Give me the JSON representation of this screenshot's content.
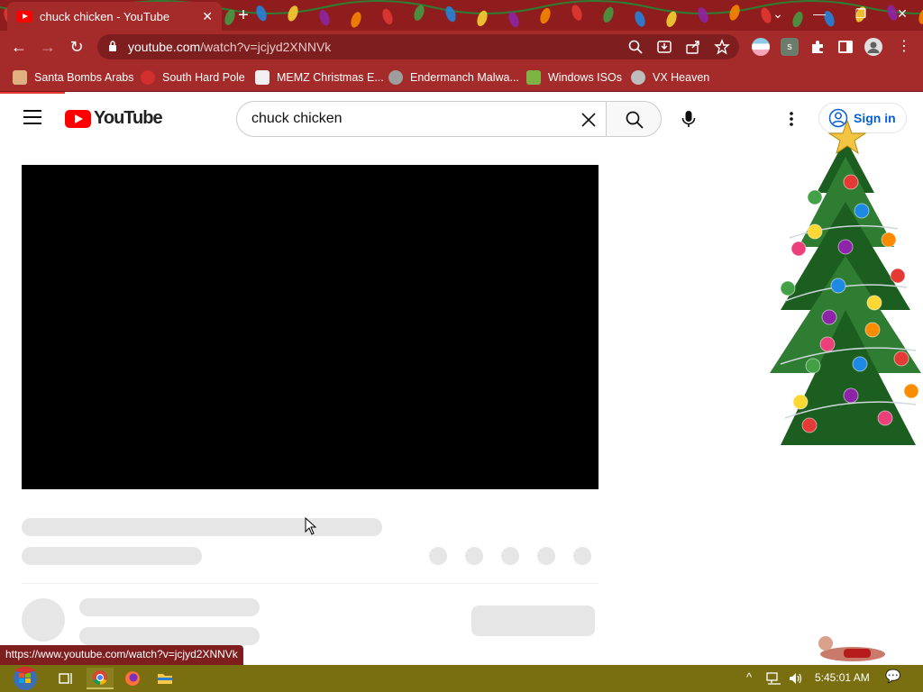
{
  "browser": {
    "tab": {
      "title": "chuck chicken - YouTube",
      "close": "✕"
    },
    "new_tab": "+",
    "window": {
      "chevron": "⌄",
      "minimize": "—",
      "restore": "❐",
      "close": "✕"
    },
    "nav": {
      "back": "←",
      "forward": "→",
      "reload": "↻"
    },
    "address": {
      "domain": "youtube.com",
      "path": "/watch?v=jcjyd2XNNVk"
    },
    "bookmarks": [
      {
        "label": "Santa Bombs Arabs",
        "icon": "santa-icon",
        "color": "#e0b080"
      },
      {
        "label": "South Hard Pole",
        "icon": "snowflake-icon",
        "color": "#d32f2f"
      },
      {
        "label": "MEMZ Christmas E...",
        "icon": "memz-icon",
        "color": "#f0f0f0"
      },
      {
        "label": "Endermanch Malwa...",
        "icon": "raccoon-icon",
        "color": "#9e9e9e"
      },
      {
        "label": "Windows ISOs",
        "icon": "gnome-icon",
        "color": "#7cb342"
      },
      {
        "label": "VX Heaven",
        "icon": "vx-icon",
        "color": "#bdbdbd"
      }
    ],
    "status_url": "https://www.youtube.com/watch?v=jcjyd2XNNVk"
  },
  "youtube": {
    "logo_text": "YouTube",
    "search": {
      "query": "chuck chicken"
    },
    "sign_in": "Sign in",
    "brand_color": "#ff0000",
    "link_color": "#065fd4"
  },
  "taskbar": {
    "clock": "5:45:01 AM",
    "tray": {
      "chevron": "^",
      "notification": "💬"
    }
  },
  "theme": {
    "chrome": "#a52a2a",
    "titlebar": "#8f1d1d",
    "taskbar": "#7a6f10"
  }
}
